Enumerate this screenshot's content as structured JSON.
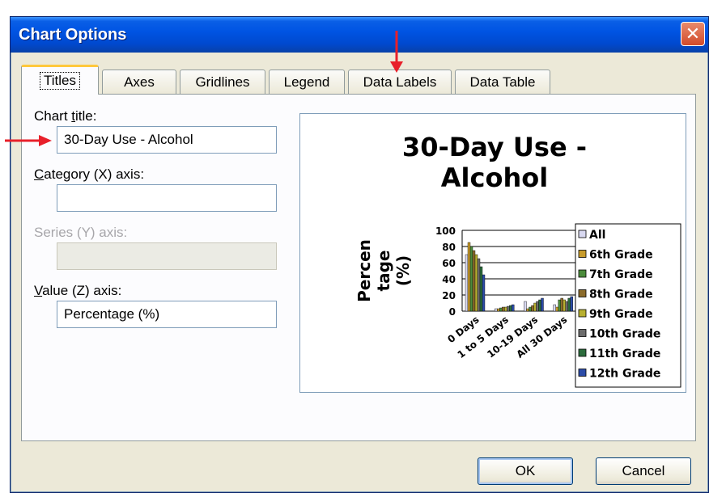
{
  "window": {
    "title": "Chart Options",
    "close_glyph": "✕"
  },
  "tabs": [
    {
      "label": "Titles",
      "active": true
    },
    {
      "label": "Axes",
      "active": false
    },
    {
      "label": "Gridlines",
      "active": false
    },
    {
      "label": "Legend",
      "active": false
    },
    {
      "label": "Data Labels",
      "active": false
    },
    {
      "label": "Data Table",
      "active": false
    }
  ],
  "fields": {
    "chart_title": {
      "label_pre": "Chart ",
      "label_u": "t",
      "label_post": "itle:",
      "value": "30-Day Use - Alcohol"
    },
    "category_axis": {
      "label_pre": "",
      "label_u": "C",
      "label_post": "ategory (X) axis:",
      "value": ""
    },
    "series_axis": {
      "label": "Series (Y) axis:",
      "value": "",
      "disabled": true
    },
    "value_axis": {
      "label_pre": "",
      "label_u": "V",
      "label_post": "alue (Z) axis:",
      "value": "Percentage (%)"
    }
  },
  "buttons": {
    "ok": "OK",
    "cancel": "Cancel"
  },
  "annotation_colors": {
    "arrow": "#E8202A"
  },
  "chart_data": {
    "type": "bar",
    "title": "30-Day Use - Alcohol",
    "ylabel_lines": [
      "Percen",
      "tage",
      "(%)"
    ],
    "ylim": [
      0,
      100
    ],
    "yticks": [
      0,
      20,
      40,
      60,
      80,
      100
    ],
    "grid": true,
    "legend_position": "right",
    "categories": [
      "0 Days",
      "1 to 5 Days",
      "10-19 Days",
      "All 30 Days"
    ],
    "series": [
      {
        "name": "All",
        "color": "#D8D8F0",
        "values": [
          70,
          3,
          12,
          8
        ]
      },
      {
        "name": "6th Grade",
        "color": "#C89C2C",
        "values": [
          85,
          3,
          3,
          5
        ]
      },
      {
        "name": "7th Grade",
        "color": "#4C8C3C",
        "values": [
          80,
          4,
          5,
          14
        ]
      },
      {
        "name": "8th Grade",
        "color": "#8C6C2C",
        "values": [
          75,
          5,
          7,
          16
        ]
      },
      {
        "name": "9th Grade",
        "color": "#B8B030",
        "values": [
          70,
          5,
          10,
          14
        ]
      },
      {
        "name": "10th Grade",
        "color": "#6C6C6C",
        "values": [
          65,
          6,
          12,
          12
        ]
      },
      {
        "name": "11th Grade",
        "color": "#2C6C3C",
        "values": [
          55,
          7,
          14,
          16
        ]
      },
      {
        "name": "12th Grade",
        "color": "#2C4CA8",
        "values": [
          45,
          8,
          16,
          18
        ]
      }
    ]
  }
}
